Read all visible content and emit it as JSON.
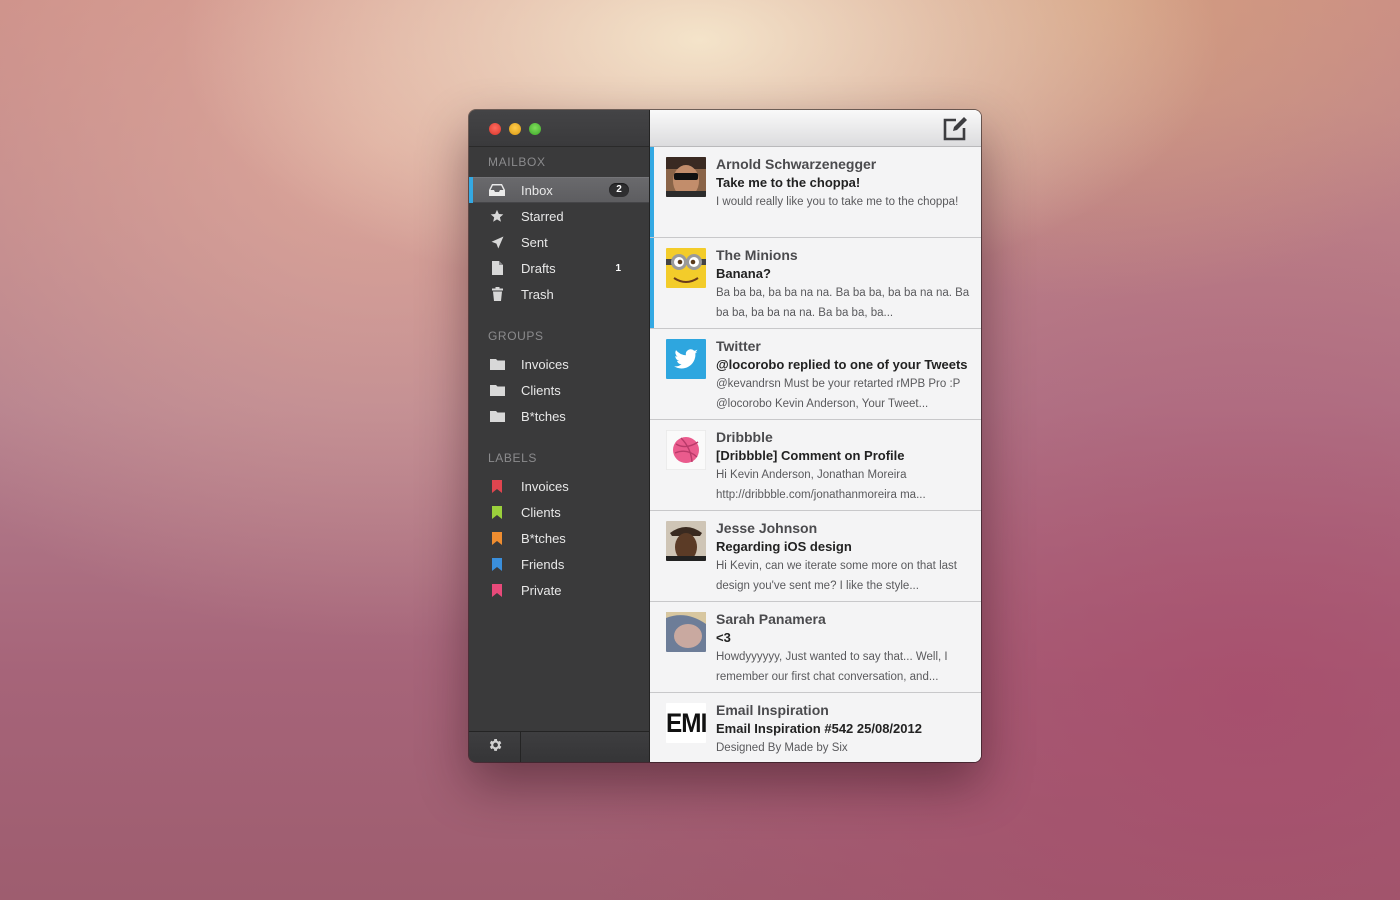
{
  "sidebar": {
    "mailbox_label": "MAILBOX",
    "mailbox": [
      {
        "label": "Inbox",
        "badge": "2",
        "icon": "inbox-icon"
      },
      {
        "label": "Starred",
        "icon": "star-icon"
      },
      {
        "label": "Sent",
        "icon": "paper-plane-icon"
      },
      {
        "label": "Drafts",
        "count": "1",
        "icon": "document-icon"
      },
      {
        "label": "Trash",
        "icon": "trash-icon"
      }
    ],
    "groups_label": "GROUPS",
    "groups": [
      {
        "label": "Invoices",
        "icon": "folder-icon"
      },
      {
        "label": "Clients",
        "icon": "folder-icon"
      },
      {
        "label": "B*tches",
        "icon": "folder-icon"
      }
    ],
    "labels_label": "LABELS",
    "labels": [
      {
        "label": "Invoices",
        "color": "#e0454f",
        "icon": "bookmark-icon"
      },
      {
        "label": "Clients",
        "color": "#9bd13c",
        "icon": "bookmark-icon"
      },
      {
        "label": "B*tches",
        "color": "#ef8d30",
        "icon": "bookmark-icon"
      },
      {
        "label": "Friends",
        "color": "#3a8fdc",
        "icon": "bookmark-icon"
      },
      {
        "label": "Private",
        "color": "#e84a7a",
        "icon": "bookmark-icon"
      }
    ]
  },
  "toolbar": {
    "compose_icon": "compose-icon"
  },
  "accent_color": "#34a9e3",
  "messages": [
    {
      "sender": "Arnold Schwarzenegger",
      "subject": "Take me to the choppa!",
      "preview": "I would really like you to take me to the choppa!",
      "unread": true
    },
    {
      "sender": "The Minions",
      "subject": "Banana?",
      "preview": "Ba ba ba, ba ba na na. Ba ba ba, ba ba na na. Ba ba ba, ba ba na na. Ba ba ba, ba...",
      "unread": true
    },
    {
      "sender": "Twitter",
      "subject": "@locorobo replied to one of your Tweets",
      "preview": "@kevandrsn Must be your retarted rMPB Pro :P @locorobo Kevin Anderson, Your Tweet...",
      "unread": false
    },
    {
      "sender": "Dribbble",
      "subject": "[Dribbble] Comment on Profile",
      "preview": "Hi Kevin Anderson, Jonathan Moreira http://dribbble.com/jonathanmoreira ma...",
      "unread": false
    },
    {
      "sender": "Jesse Johnson",
      "subject": "Regarding iOS design",
      "preview": "Hi Kevin, can we iterate some more on that last design you've sent me? I like the style...",
      "unread": false
    },
    {
      "sender": "Sarah Panamera",
      "subject": "<3",
      "preview": "Howdyyyyyy, Just wanted to say that... Well, I remember our first chat conversation, and...",
      "unread": false
    },
    {
      "sender": "Email Inspiration",
      "subject": "Email Inspiration #542 25/08/2012",
      "preview": "Designed By Made by Six",
      "avatar_text": "EMI",
      "unread": false
    }
  ]
}
